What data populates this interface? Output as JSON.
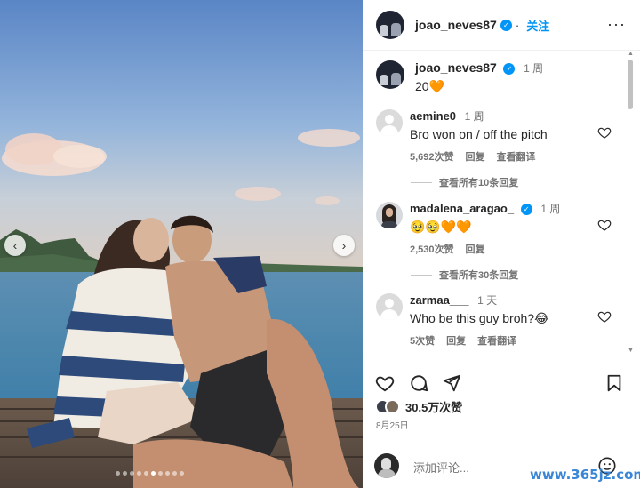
{
  "post": {
    "author": "joao_neves87",
    "follow_label": "关注",
    "caption_time": "1 周",
    "caption_text": "20🧡",
    "likes": "30.5万次赞",
    "date": "8月25日",
    "add_comment_placeholder": "添加评论...",
    "carousel": {
      "dot_count": 10,
      "active_index": 5
    }
  },
  "comments": [
    {
      "username": "aemine0",
      "time": "1 周",
      "text": "Bro won on / off the pitch",
      "likes": "5,692次赞",
      "reply_label": "回复",
      "translate_label": "查看翻译",
      "view_replies": "查看所有10条回复"
    },
    {
      "username": "madalena_aragao_",
      "time": "1 周",
      "text": "🥹🥹🧡🧡",
      "likes": "2,530次赞",
      "reply_label": "回复",
      "view_replies": "查看所有30条回复"
    },
    {
      "username": "zarmaa___",
      "time": "1 天",
      "text": "Who be this guy broh?😂",
      "likes": "5次赞",
      "reply_label": "回复",
      "translate_label": "查看翻译"
    }
  ],
  "watermark": "www.365jz.com",
  "icons": {
    "more": "more-options-icon",
    "heart": "heart-icon",
    "comment": "comment-icon",
    "share": "share-icon",
    "bookmark": "bookmark-icon",
    "emoji": "emoji-icon"
  },
  "colors": {
    "accent": "#0095f6",
    "text": "#262626",
    "muted": "#737373"
  }
}
